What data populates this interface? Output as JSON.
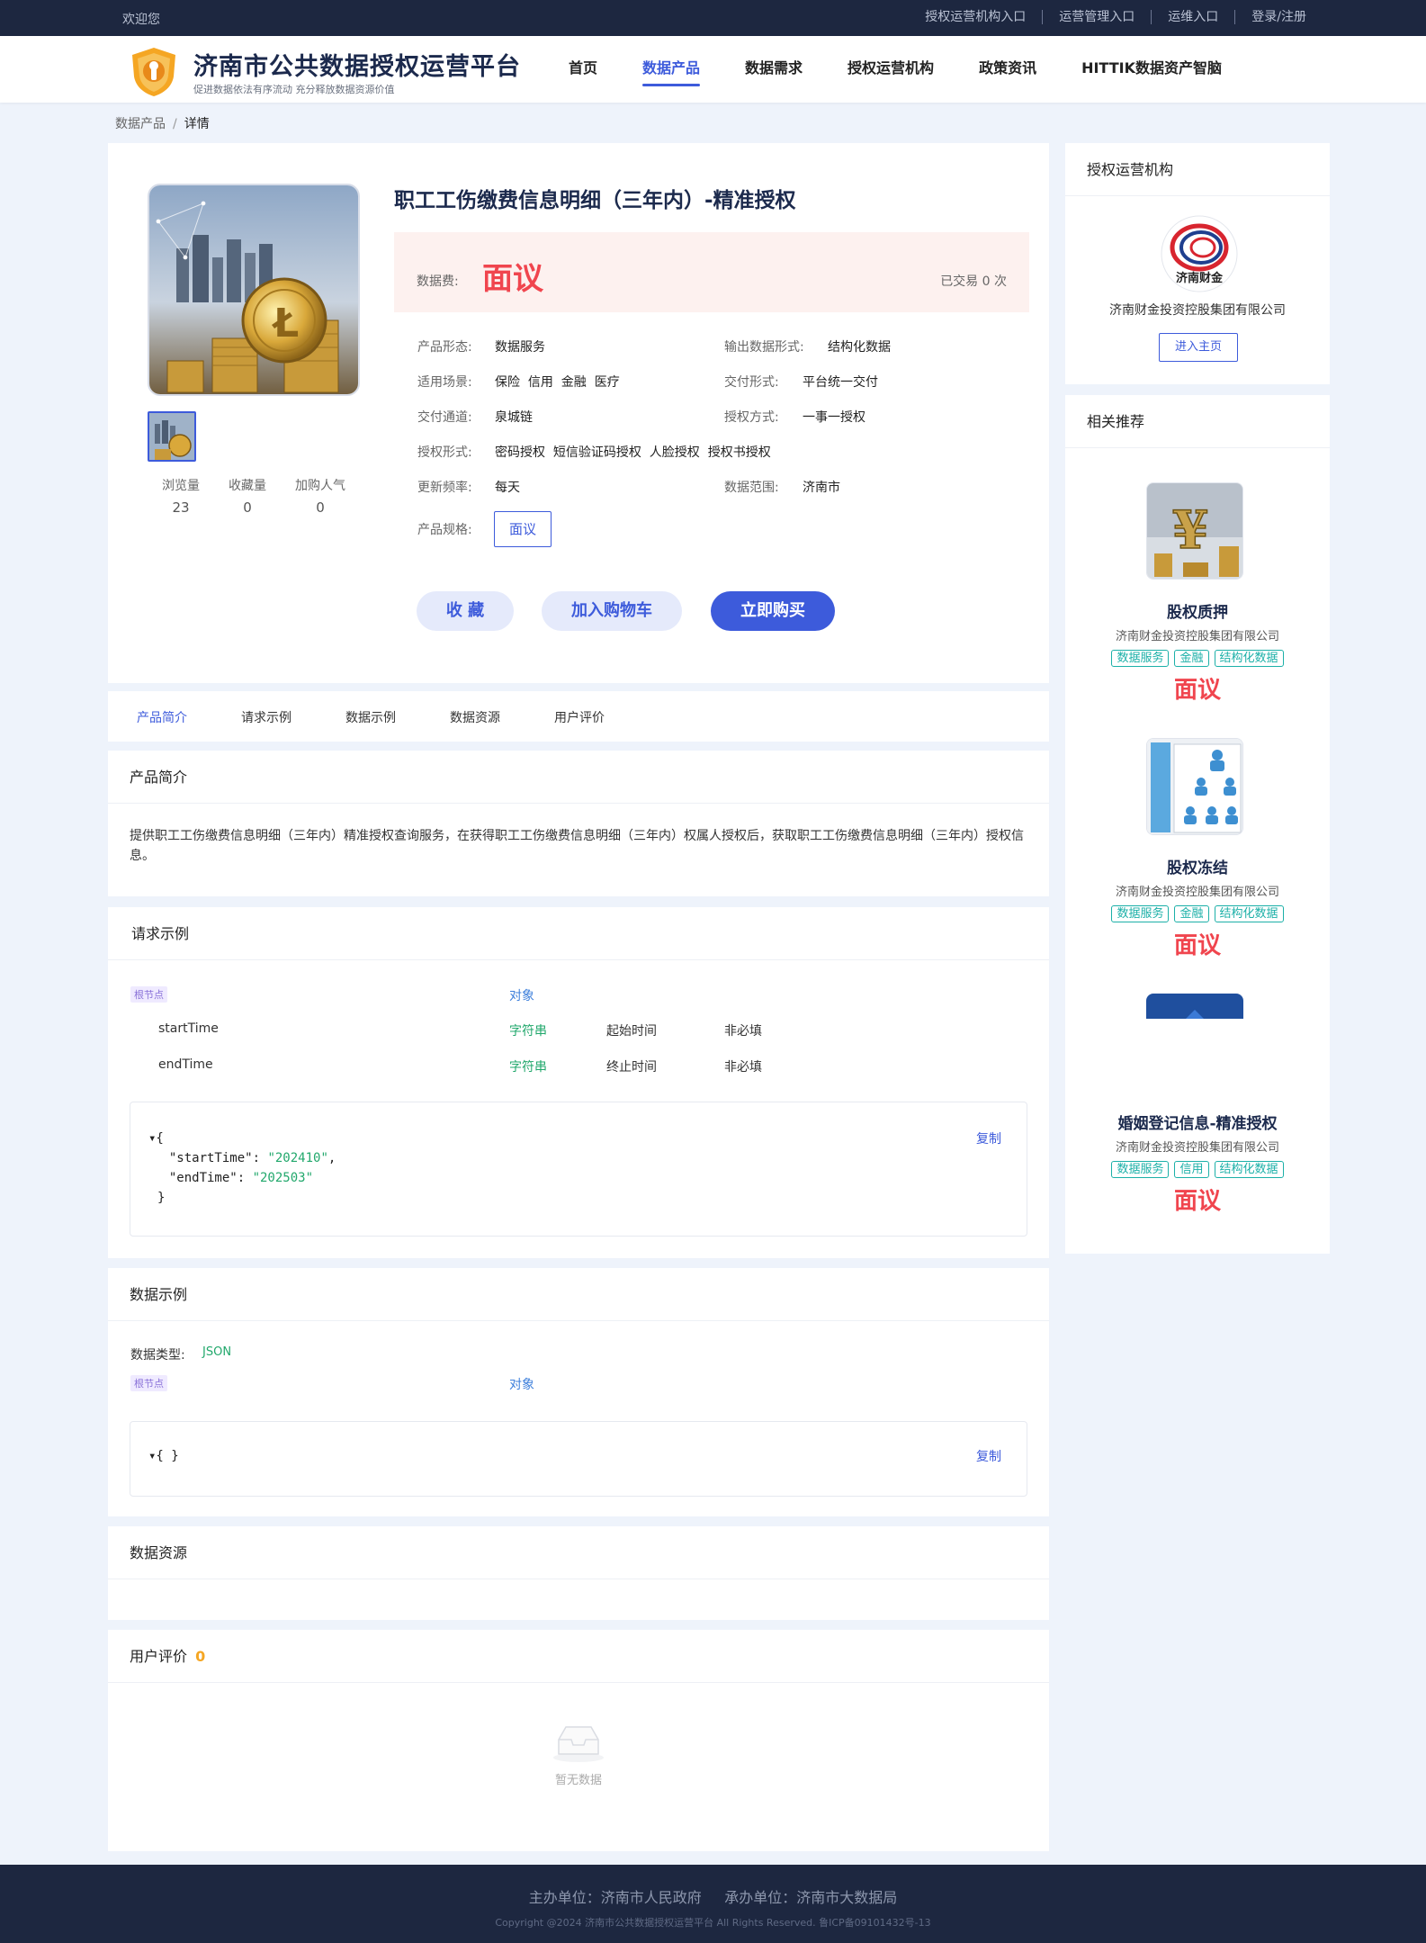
{
  "topbar": {
    "welcome": "欢迎您",
    "links": [
      "授权运营机构入口",
      "运营管理入口",
      "运维入口",
      "登录/注册"
    ]
  },
  "header": {
    "title": "济南市公共数据授权运营平台",
    "slogan": "促进数据依法有序流动 充分释放数据资源价值",
    "nav": [
      "首页",
      "数据产品",
      "数据需求",
      "授权运营机构",
      "政策资讯",
      "HITTIK数据资产智脑"
    ],
    "active_nav": "数据产品"
  },
  "breadcrumb": {
    "parent": "数据产品",
    "sep": "/",
    "current": "详情"
  },
  "product": {
    "title": "职工工伤缴费信息明细（三年内）-精准授权",
    "price_label": "数据费:",
    "price": "面议",
    "traded": "已交易 0 次",
    "stats": [
      {
        "label": "浏览量",
        "value": "23"
      },
      {
        "label": "收藏量",
        "value": "0"
      },
      {
        "label": "加购人气",
        "value": "0"
      }
    ],
    "attrs": {
      "form_k": "产品形态:",
      "form_v": "数据服务",
      "output_k": "输出数据形式:",
      "output_v": "结构化数据",
      "scene_k": "适用场景:",
      "scene_v": "保险  信用  金融  医疗",
      "delivery_k": "交付形式:",
      "delivery_v": "平台统一交付",
      "channel_k": "交付通道:",
      "channel_v": "泉城链",
      "authway_k": "授权方式:",
      "authway_v": "一事一授权",
      "authform_k": "授权形式:",
      "authform_v": "密码授权  短信验证码授权  人脸授权  授权书授权",
      "freq_k": "更新频率:",
      "freq_v": "每天",
      "range_k": "数据范围:",
      "range_v": "济南市",
      "spec_k": "产品规格:",
      "spec_v": "面议"
    },
    "buttons": {
      "favorite": "收 藏",
      "cart": "加入购物车",
      "buy": "立即购买"
    }
  },
  "tabs": [
    "产品简介",
    "请求示例",
    "数据示例",
    "数据资源",
    "用户评价"
  ],
  "intro": {
    "title": "产品简介",
    "text": "提供职工工伤缴费信息明细（三年内）精准授权查询服务，在获得职工工伤缴费信息明细（三年内）权属人授权后，获取职工工伤缴费信息明细（三年内）授权信息。"
  },
  "request": {
    "title": "请求示例",
    "root_tag": "根节点",
    "root_type": "对象",
    "fields": [
      {
        "name": "startTime",
        "type": "字符串",
        "desc": "起始时间",
        "required": "非必填"
      },
      {
        "name": "endTime",
        "type": "字符串",
        "desc": "终止时间",
        "required": "非必填"
      }
    ],
    "copy": "复制",
    "code": {
      "open": "▾{",
      "k1": "  \"startTime\": ",
      "v1": "\"202410\"",
      "c1": ",",
      "k2": "  \"endTime\": ",
      "v2": "\"202503\"",
      "close": "}"
    }
  },
  "sample": {
    "title": "数据示例",
    "type_label": "数据类型:",
    "type_value": "JSON",
    "root_tag": "根节点",
    "root_type": "对象",
    "code": "▾{ }",
    "copy": "复制"
  },
  "resources": {
    "title": "数据资源"
  },
  "reviews": {
    "title": "用户评价",
    "count": "0",
    "empty": "暂无数据"
  },
  "sidebar": {
    "org_title": "授权运营机构",
    "org_logo_text": "济南财金",
    "org_name": "济南财金投资控股集团有限公司",
    "org_button": "进入主页",
    "rec_title": "相关推荐",
    "recs": [
      {
        "name": "股权质押",
        "company": "济南财金投资控股集团有限公司",
        "tags": [
          "数据服务",
          "金融",
          "结构化数据"
        ],
        "price": "面议"
      },
      {
        "name": "股权冻结",
        "company": "济南财金投资控股集团有限公司",
        "tags": [
          "数据服务",
          "金融",
          "结构化数据"
        ],
        "price": "面议"
      },
      {
        "name": "婚姻登记信息-精准授权",
        "company": "济南财金投资控股集团有限公司",
        "tags": [
          "数据服务",
          "信用",
          "结构化数据"
        ],
        "price": "面议"
      }
    ]
  },
  "footer": {
    "line1": "主办单位：济南市人民政府     承办单位：济南市大数据局",
    "line2": "Copyright @2024 济南市公共数据授权运营平台 All Rights Reserved. 鲁ICP备09101432号-13"
  },
  "colors": {
    "primary": "#3d5bdb",
    "price": "#f0454e",
    "dark": "#1d2740",
    "tag": "#1cb0a8"
  }
}
